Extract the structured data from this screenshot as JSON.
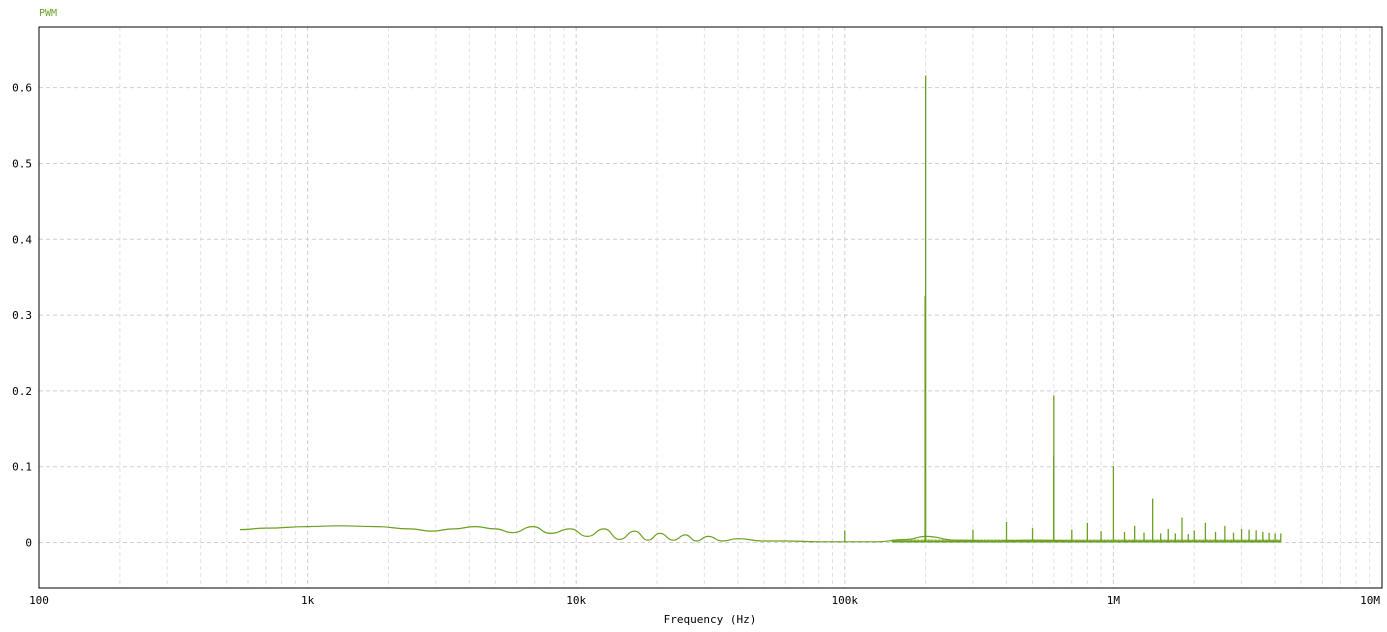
{
  "chart_data": {
    "type": "line",
    "title": "",
    "xlabel": "Frequency (Hz)",
    "ylabel": "",
    "xscale": "log",
    "xlim": [
      100,
      10000000
    ],
    "ylim": [
      -0.06,
      0.68
    ],
    "grid": true,
    "legend": "top-left",
    "x_tick_values": [
      100,
      1000,
      10000,
      100000,
      1000000,
      10000000
    ],
    "x_tick_labels": [
      "100",
      "1k",
      "10k",
      "100k",
      "1M",
      "10M"
    ],
    "y_tick_values": [
      0,
      0.1,
      0.2,
      0.3,
      0.4,
      0.5,
      0.6
    ],
    "y_tick_labels": [
      "0",
      "0.1",
      "0.2",
      "0.3",
      "0.4",
      "0.5",
      "0.6"
    ],
    "series": [
      {
        "name": "PWM",
        "color": "#6aa121",
        "baseline": [
          [
            560,
            0.017
          ],
          [
            700,
            0.019
          ],
          [
            1000,
            0.021
          ],
          [
            1300,
            0.022
          ],
          [
            1800,
            0.021
          ],
          [
            2400,
            0.018
          ],
          [
            2900,
            0.015
          ],
          [
            3500,
            0.018
          ],
          [
            4200,
            0.021
          ],
          [
            5000,
            0.018
          ],
          [
            5800,
            0.013
          ],
          [
            6900,
            0.021
          ],
          [
            8000,
            0.012
          ],
          [
            9500,
            0.018
          ],
          [
            11000,
            0.008
          ],
          [
            12700,
            0.018
          ],
          [
            14500,
            0.004
          ],
          [
            16500,
            0.015
          ],
          [
            18500,
            0.003
          ],
          [
            20500,
            0.012
          ],
          [
            23000,
            0.003
          ],
          [
            25500,
            0.01
          ],
          [
            28000,
            0.002
          ],
          [
            31000,
            0.008
          ],
          [
            35000,
            0.002
          ],
          [
            40000,
            0.005
          ],
          [
            50000,
            0.002
          ],
          [
            60000,
            0.002
          ],
          [
            80000,
            0.001
          ],
          [
            100000,
            0.001
          ],
          [
            130000,
            0.001
          ],
          [
            170000,
            0.004
          ],
          [
            200000,
            0.008
          ],
          [
            260000,
            0.003
          ],
          [
            350000,
            0.002
          ],
          [
            500000,
            0.003
          ],
          [
            800000,
            0.002
          ],
          [
            1200000,
            0.002
          ],
          [
            2000000,
            0.002
          ],
          [
            4200000,
            0.002
          ]
        ],
        "peaks": [
          [
            100000,
            0.016
          ],
          [
            199000,
            0.325
          ],
          [
            200000,
            0.616
          ],
          [
            300000,
            0.017
          ],
          [
            400000,
            0.027
          ],
          [
            500000,
            0.019
          ],
          [
            599000,
            0.113
          ],
          [
            600000,
            0.194
          ],
          [
            700000,
            0.017
          ],
          [
            800000,
            0.026
          ],
          [
            900000,
            0.015
          ],
          [
            1000000,
            0.101
          ],
          [
            1100000,
            0.014
          ],
          [
            1200000,
            0.022
          ],
          [
            1300000,
            0.013
          ],
          [
            1400000,
            0.058
          ],
          [
            1500000,
            0.012
          ],
          [
            1600000,
            0.018
          ],
          [
            1700000,
            0.012
          ],
          [
            1800000,
            0.033
          ],
          [
            1900000,
            0.011
          ],
          [
            2000000,
            0.016
          ],
          [
            2200000,
            0.026
          ],
          [
            2400000,
            0.014
          ],
          [
            2600000,
            0.022
          ],
          [
            2800000,
            0.013
          ],
          [
            3000000,
            0.018
          ],
          [
            3200000,
            0.017
          ],
          [
            3400000,
            0.016
          ],
          [
            3600000,
            0.014
          ],
          [
            3800000,
            0.013
          ],
          [
            4000000,
            0.012
          ],
          [
            4200000,
            0.012
          ]
        ]
      }
    ]
  }
}
